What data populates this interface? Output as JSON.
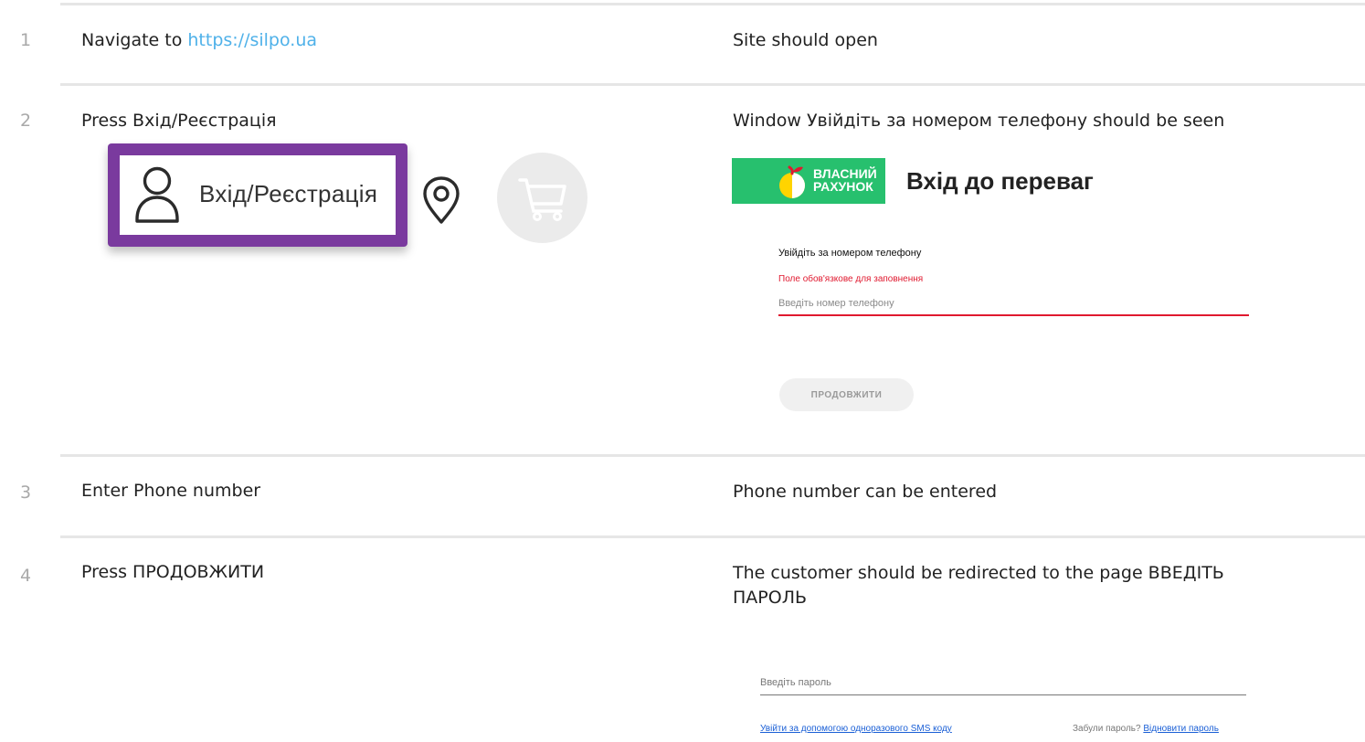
{
  "steps": [
    {
      "num": "1",
      "action_prefix": "Navigate to ",
      "action_link": "https://silpo.ua",
      "expected": "Site should open"
    },
    {
      "num": "2",
      "action": "Press Вхід/Реєстрація",
      "expected": "Window Увійдіть за номером телефону should be seen"
    },
    {
      "num": "3",
      "action": "Enter Phone number",
      "expected": "Phone number can be entered"
    },
    {
      "num": "4",
      "action": "Press ПРОДОВЖИТИ",
      "expected": "The customer should be redirected to the page ВВЕДІТЬ ПАРОЛЬ"
    }
  ],
  "header_screenshot": {
    "login_label": "Вхід/Реєстрація",
    "highlight_color": "#7a3a9e",
    "icons": [
      "user-icon",
      "location-pin-icon",
      "cart-icon"
    ]
  },
  "login_form": {
    "brand_line1": "ВЛАСНИЙ",
    "brand_line2": "РАХУНОК",
    "brand_color": "#27c06e",
    "title": "Вхід до переваг",
    "phone_label": "Увійдіть за номером телефону",
    "error": "Поле обов'язкове для заповнення",
    "phone_placeholder": "Введіть номер телефону",
    "continue_label": "ПРОДОВЖИТИ",
    "error_color": "#e0192f"
  },
  "password_form": {
    "password_placeholder": "Введіть пароль",
    "sms_link": "Увійти за допомогою одноразового SMS коду",
    "forgot_prefix": "Забули пароль? ",
    "restore_link": "Відновити пароль"
  }
}
